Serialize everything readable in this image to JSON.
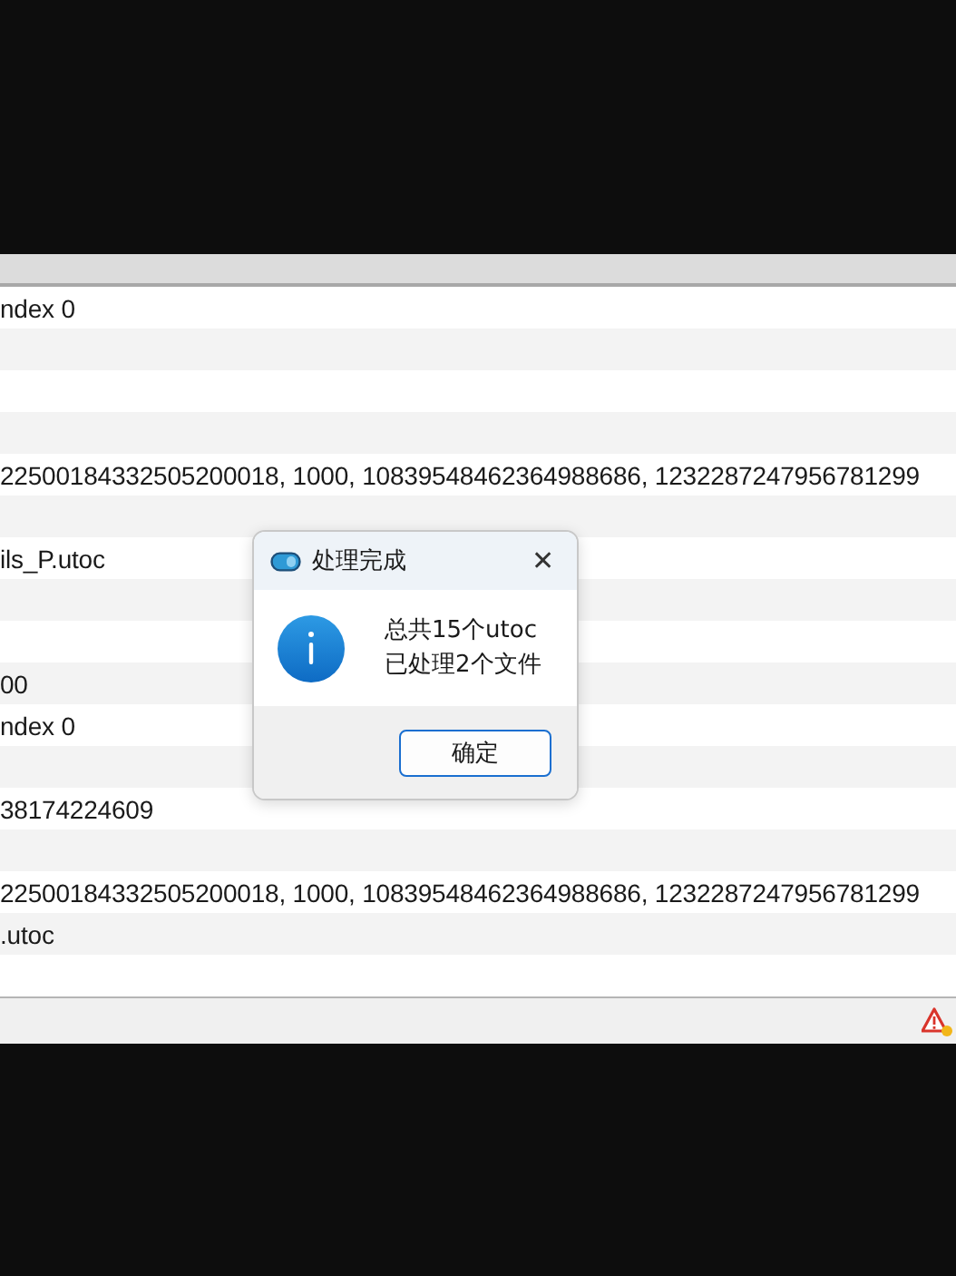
{
  "log_rows": [
    {
      "text": "ndex 0"
    },
    {},
    {},
    {},
    {
      "text": "22500184332505200018, 1000, 10839548462364988686, 1232287247956781299"
    },
    {},
    {
      "text": "ils_P.utoc"
    },
    {},
    {},
    {
      "text": "00"
    },
    {
      "text": "ndex 0"
    },
    {},
    {
      "text": "38174224609"
    },
    {},
    {
      "text": "22500184332505200018, 1000, 10839548462364988686, 1232287247956781299"
    },
    {
      "text": ".utoc"
    },
    {}
  ],
  "dialog": {
    "title": "处理完成",
    "close": "✕",
    "message_lines": [
      "总共15个utoc",
      "已处理2个文件"
    ],
    "button": "确定"
  },
  "status_bar": {
    "warning": true
  }
}
